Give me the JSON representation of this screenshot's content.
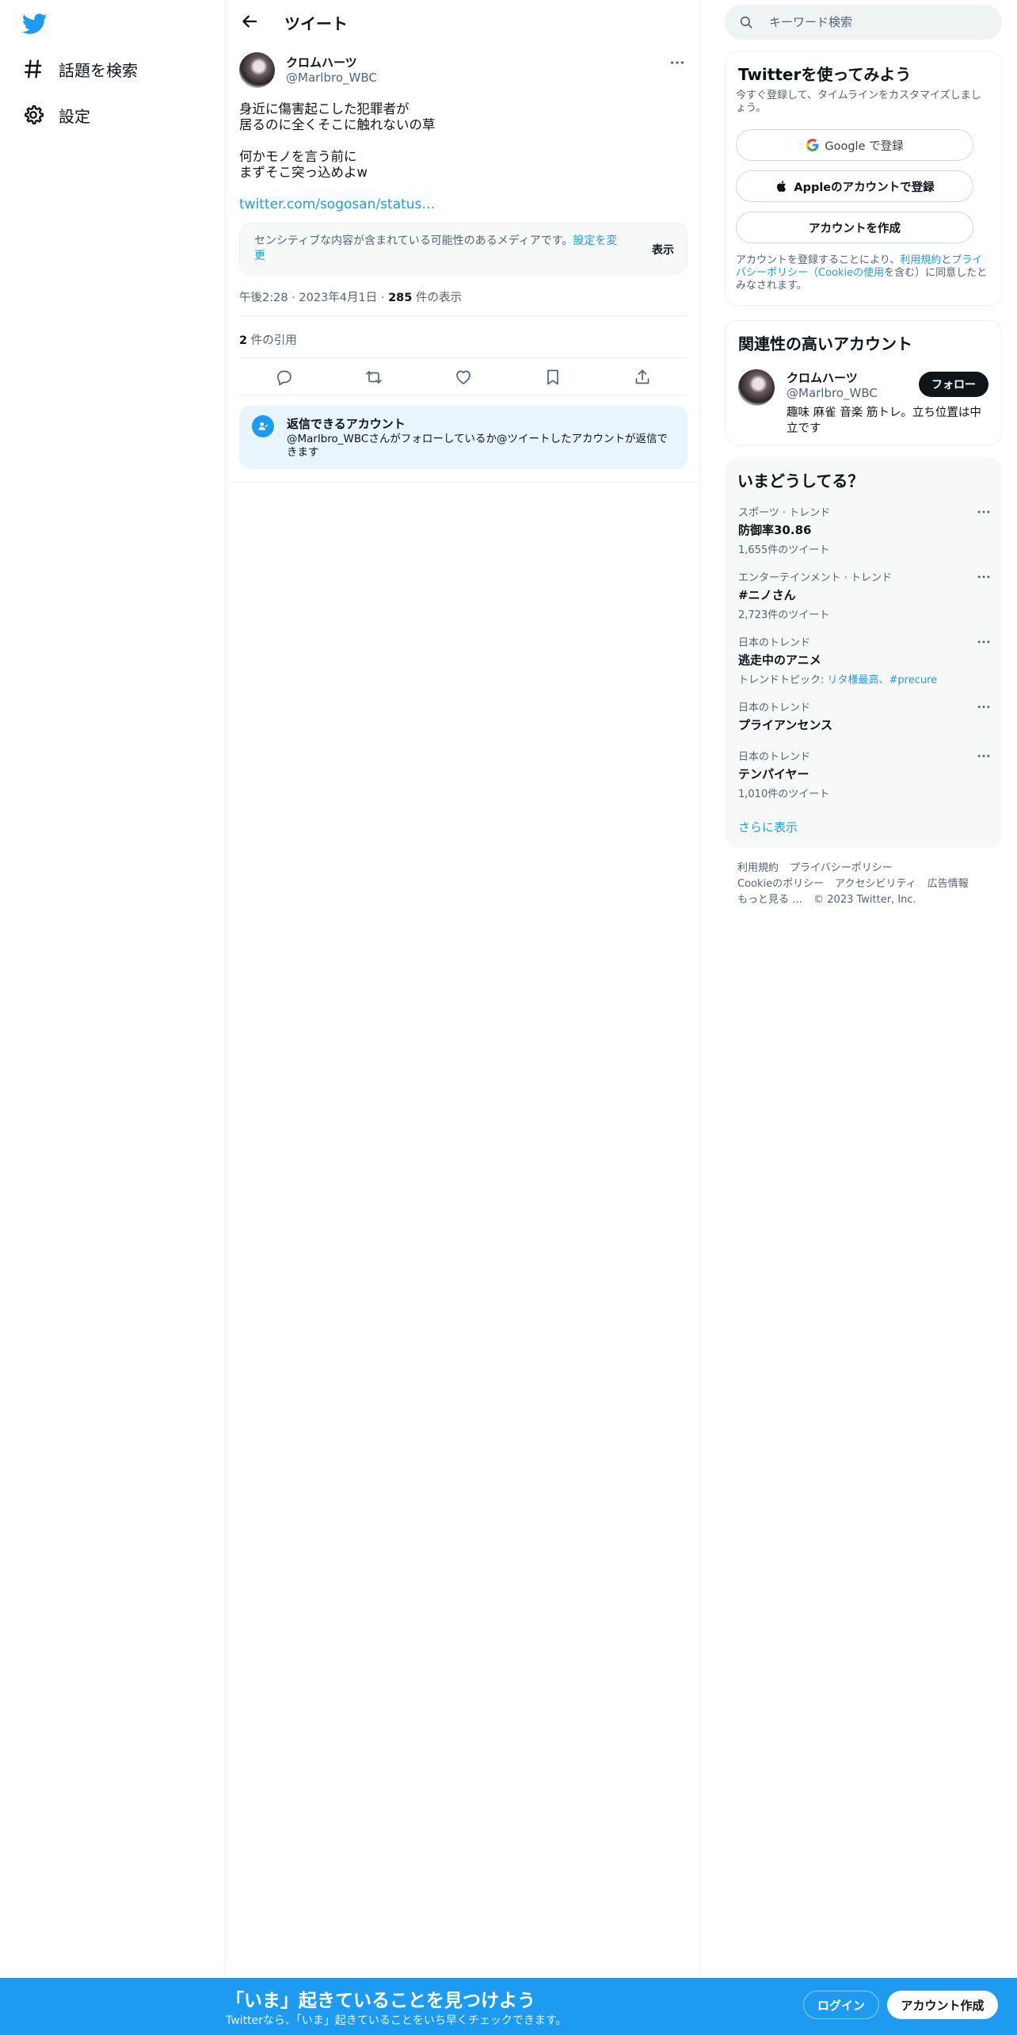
{
  "sidebar": {
    "items": [
      {
        "label": "話題を検索",
        "icon": "hashtag-icon"
      },
      {
        "label": "設定",
        "icon": "gear-icon"
      }
    ]
  },
  "header": {
    "title": "ツイート"
  },
  "tweet": {
    "author_name": "クロムハーツ",
    "author_handle": "@Marlbro_WBC",
    "text": "身近に傷害起こした犯罪者が\n居るのに全くそこに触れないの草\n\n何かモノを言う前に\nまずそこ突っ込めよw",
    "link": "twitter.com/sogosan/status…",
    "sensitive_text": "センシティブな内容が含まれている可能性のあるメディアです。",
    "sensitive_link": "設定を変更",
    "sensitive_show": "表示",
    "time": "午後2:28",
    "date": "2023年4月1日",
    "views_count": "285",
    "views_label": "件の表示",
    "quotes_count": "2",
    "quotes_label": "件の引用"
  },
  "reply_restriction": {
    "title": "返信できるアカウント",
    "description": "@Marlbro_WBCさんがフォローしているか@ツイートしたアカウントが返信できます"
  },
  "search": {
    "placeholder": "キーワード検索"
  },
  "signup": {
    "title": "Twitterを使ってみよう",
    "subtitle": "今すぐ登録して、タイムラインをカスタマイズしましょう。",
    "google_label": "Google で登録",
    "apple_label": "Appleのアカウントで登録",
    "create_label": "アカウントを作成",
    "terms_prefix": "アカウントを登録することにより、",
    "terms_link": "利用規約",
    "terms_and": "と",
    "privacy_link": "プライバシーポリシー（Cookieの使用",
    "terms_suffix": "を含む）に同意したとみなされます。"
  },
  "related": {
    "title": "関連性の高いアカウント",
    "name": "クロムハーツ",
    "handle": "@Marlbro_WBC",
    "follow_label": "フォロー",
    "bio": "趣味 麻雀 音楽 筋トレ。立ち位置は中立です"
  },
  "trends": {
    "title": "いまどうしてる？",
    "items": [
      {
        "category": "スポーツ · トレンド",
        "name": "防御率30.86",
        "count": "1,655件のツイート"
      },
      {
        "category": "エンターテインメント · トレンド",
        "name": "#ニノさん",
        "count": "2,723件のツイート"
      },
      {
        "category": "日本のトレンド",
        "name": "逃走中のアニメ",
        "count_prefix": "トレンドトピック: ",
        "count_links": "リタ様最高、#precure"
      },
      {
        "category": "日本のトレンド",
        "name": "プライアンセンス"
      },
      {
        "category": "日本のトレンド",
        "name": "テンパイヤー",
        "count": "1,010件のツイート"
      }
    ],
    "show_more": "さらに表示"
  },
  "footer": {
    "links": [
      "利用規約",
      "プライバシーポリシー",
      "Cookieのポリシー",
      "アクセシビリティ",
      "広告情報",
      "もっと見る …",
      "© 2023 Twitter, Inc."
    ]
  },
  "bottom_bar": {
    "title": "「いま」起きていることを見つけよう",
    "subtitle": "Twitterなら、「いま」起きていることをいち早くチェックできます。",
    "login_label": "ログイン",
    "signup_label": "アカウント作成"
  },
  "colors": {
    "accent": "#1d9bf0",
    "text": "#0f1419",
    "muted": "#536471",
    "border": "#eff3f4"
  }
}
